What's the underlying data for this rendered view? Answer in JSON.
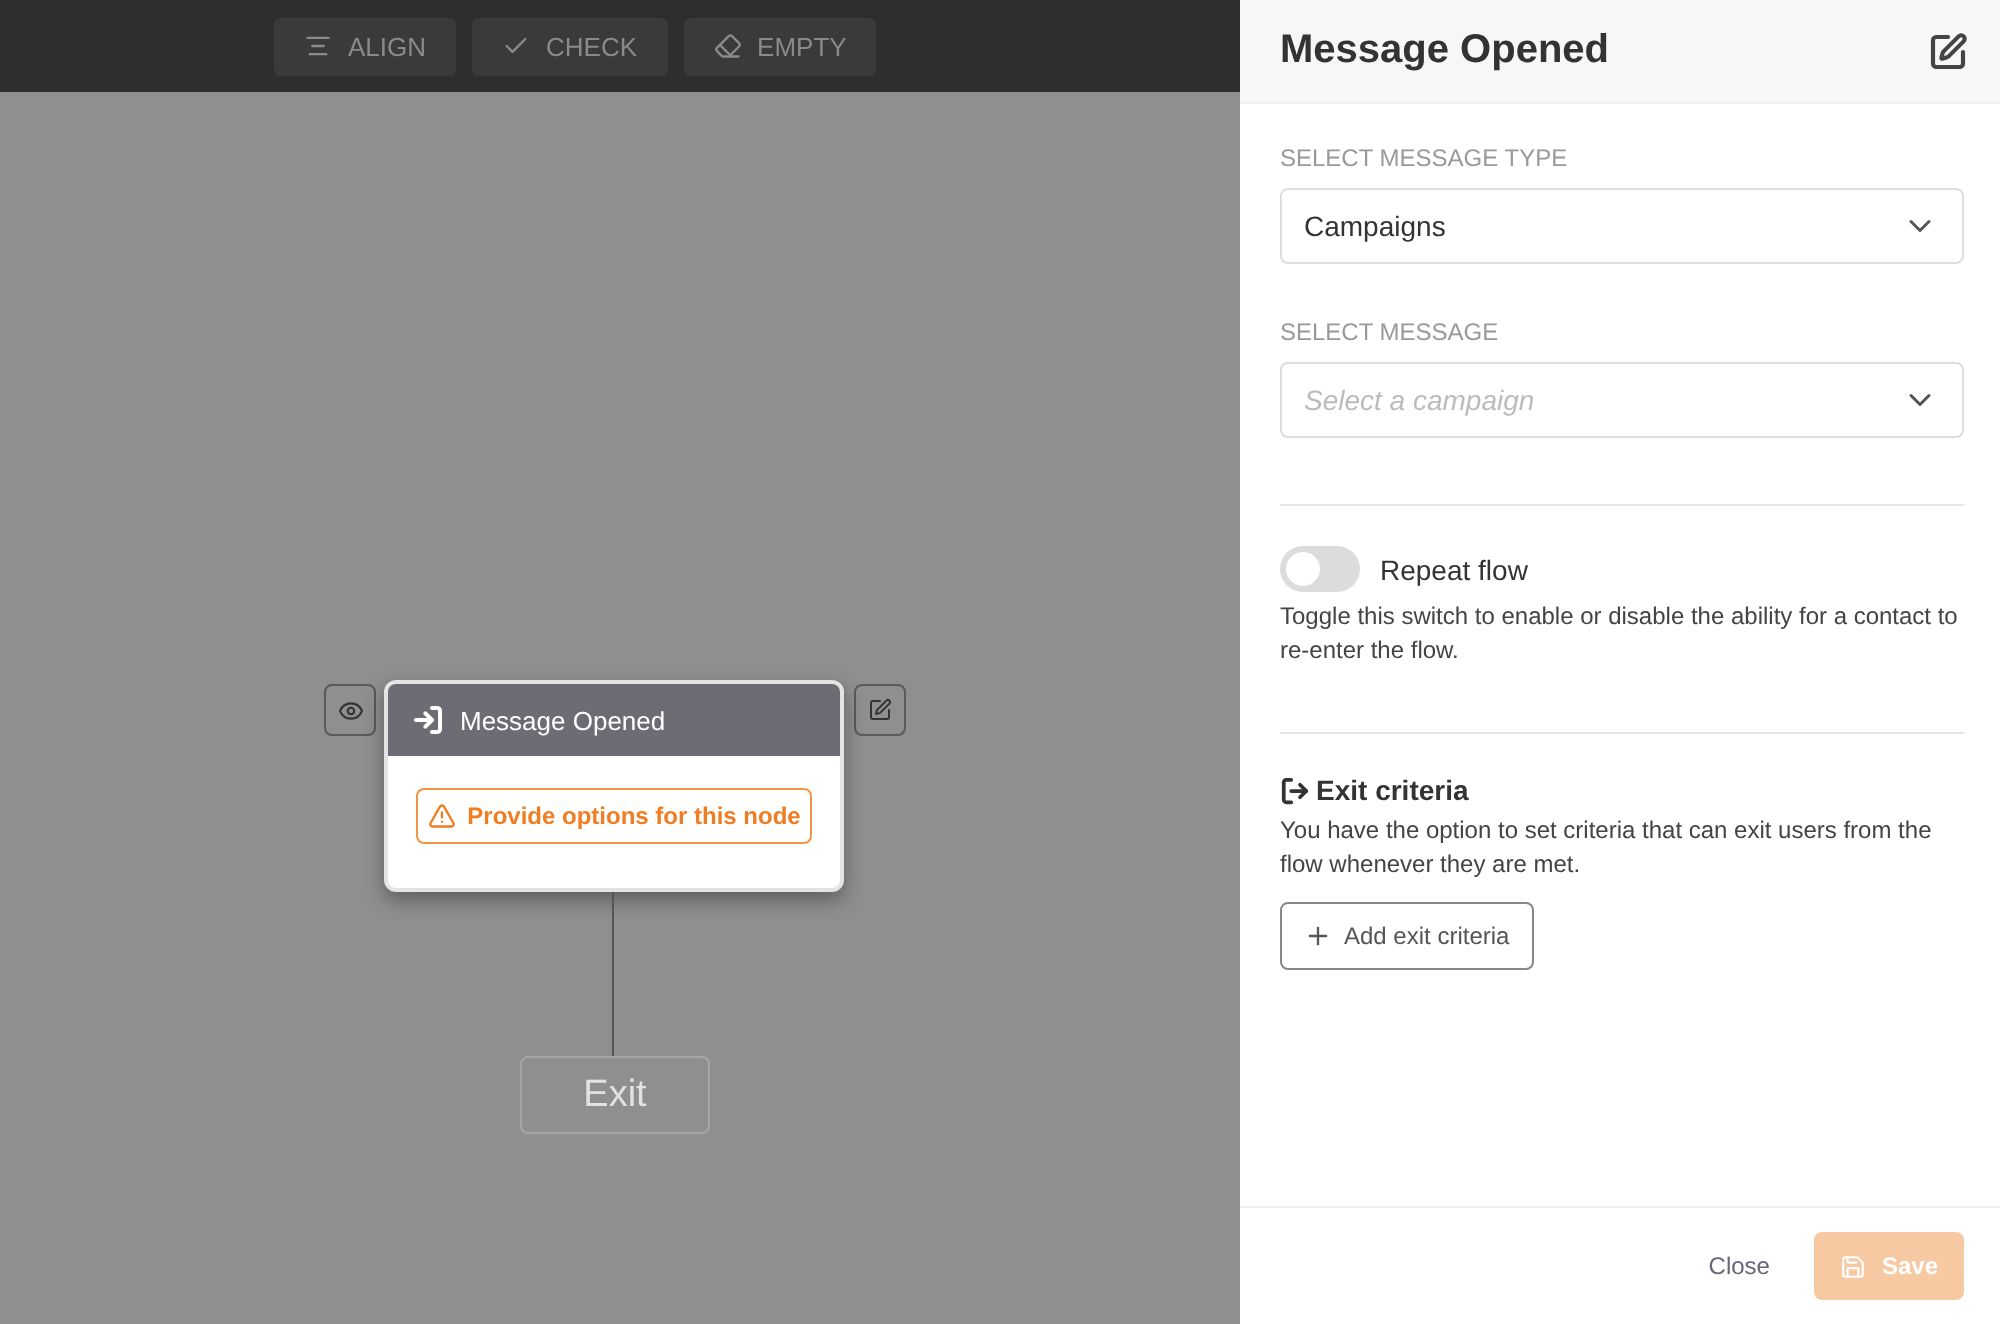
{
  "toolbar": [
    {
      "kind": "align",
      "label": "ALIGN"
    },
    {
      "kind": "check",
      "label": "CHECK"
    },
    {
      "kind": "erase",
      "label": "EMPTY"
    }
  ],
  "node": {
    "title": "Message Opened",
    "warning": "Provide options for this node"
  },
  "exit_node": {
    "label": "Exit"
  },
  "panel": {
    "title": "Message Opened",
    "fields": [
      {
        "label": "SELECT MESSAGE TYPE",
        "value": "Campaigns"
      },
      {
        "label": "SELECT MESSAGE",
        "placeholder": "Select a campaign"
      }
    ],
    "repeat": {
      "label": "Repeat flow",
      "on": false,
      "help": "Toggle this switch to enable or disable the ability for a contact to re-enter the flow."
    },
    "exit_criteria": {
      "title": "Exit criteria",
      "description": "You have the option to set criteria that can exit users from the flow whenever they are met.",
      "button": "Add exit criteria"
    },
    "footer": {
      "close": "Close",
      "save": {
        "label": "Save",
        "disabled": true
      }
    }
  }
}
